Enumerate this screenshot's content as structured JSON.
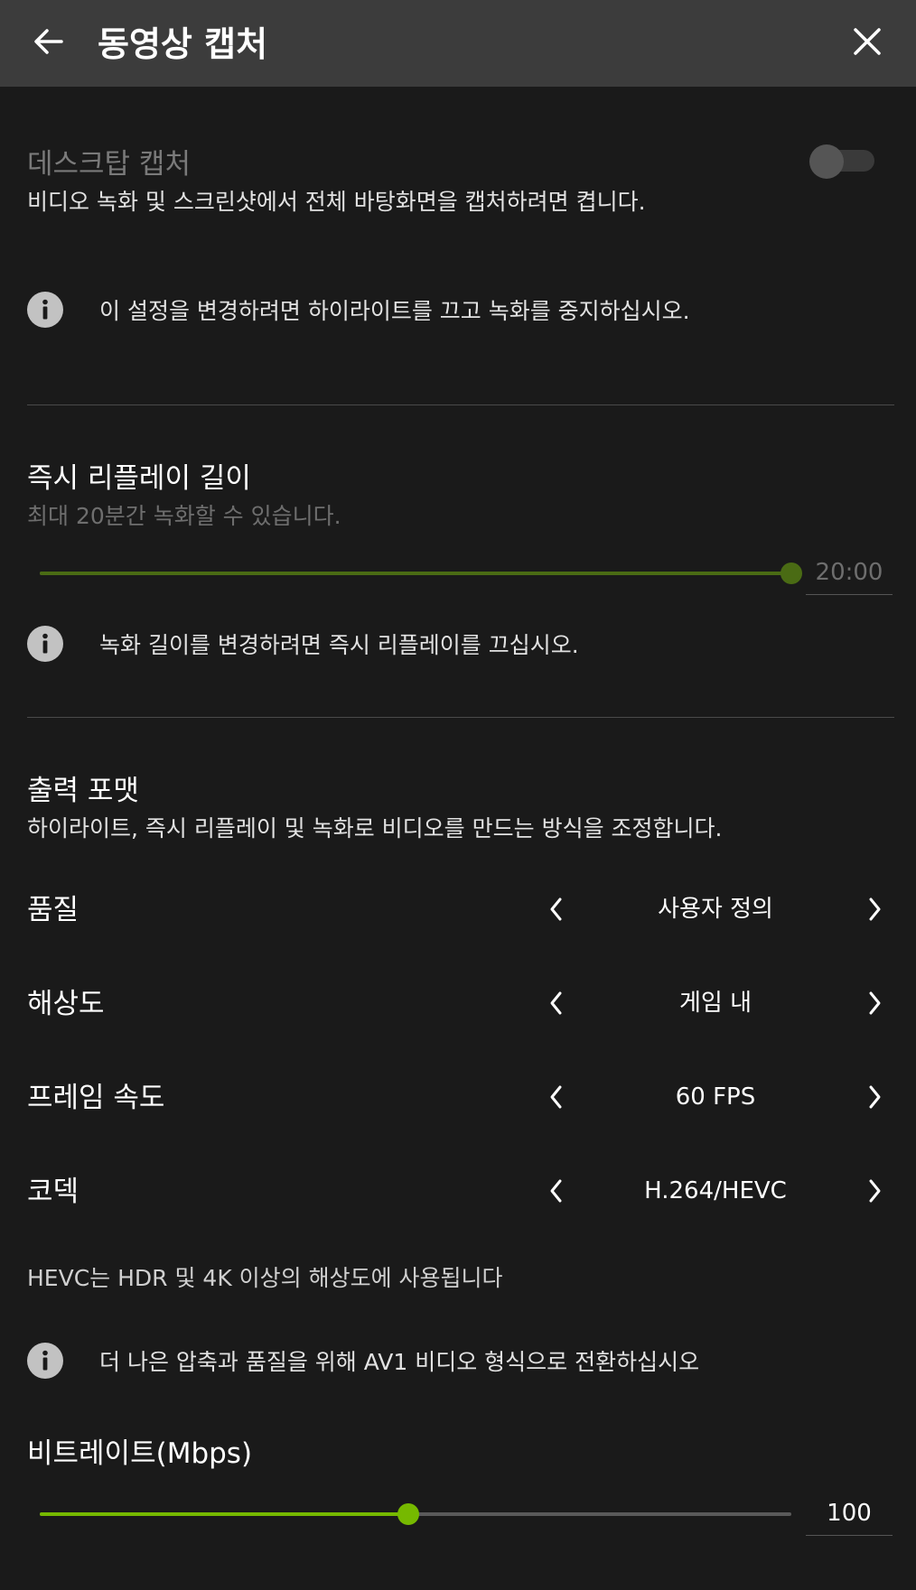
{
  "header": {
    "title": "동영상 캡처",
    "back_icon": "arrow-left-icon",
    "close_icon": "close-icon"
  },
  "desktop_capture": {
    "title": "데스크탑 캡처",
    "description": "비디오 녹화 및 스크린샷에서 전체 바탕화면을 캡처하려면 켭니다.",
    "enabled": false,
    "info": "이 설정을 변경하려면 하이라이트를 끄고 녹화를 중지하십시오."
  },
  "instant_replay": {
    "title": "즉시 리플레이 길이",
    "description": "최대 20분간 녹화할 수 있습니다.",
    "value": "20:00",
    "slider_fraction": 1.0,
    "info": "녹화 길이를 변경하려면 즉시 리플레이를 끄십시오."
  },
  "output_format": {
    "title": "출력 포맷",
    "description": "하이라이트, 즉시 리플레이 및 녹화로 비디오를 만드는 방식을 조정합니다.",
    "settings": [
      {
        "label": "품질",
        "value": "사용자 정의"
      },
      {
        "label": "해상도",
        "value": "게임 내"
      },
      {
        "label": "프레임 속도",
        "value": "60 FPS"
      },
      {
        "label": "코덱",
        "value": "H.264/HEVC"
      }
    ],
    "codec_note": "HEVC는 HDR 및 4K 이상의 해상도에 사용됩니다",
    "info": "더 나은 압축과 품질을 위해 AV1 비디오 형식으로 전환하십시오"
  },
  "bitrate": {
    "title": "비트레이트(Mbps)",
    "value": "100",
    "slider_fraction": 0.49
  },
  "colors": {
    "accent": "#76b900",
    "accent_disabled": "#4a6b14",
    "header_bg": "#3c3c3c",
    "page_bg": "#1a1a1a"
  }
}
